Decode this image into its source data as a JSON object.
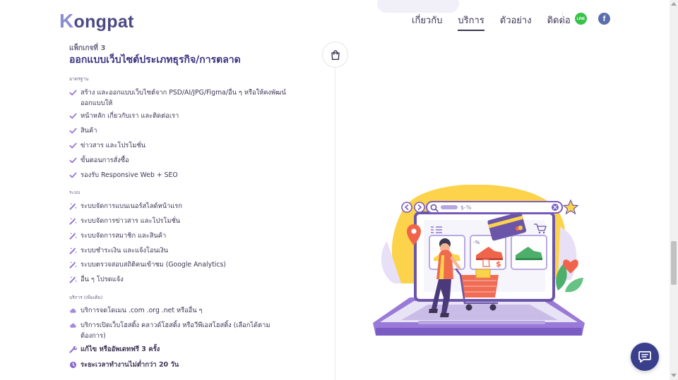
{
  "header": {
    "logo_k": "K",
    "logo_rest": "ongpat",
    "nav": [
      "เกี่ยวกับ",
      "บริการ",
      "ตัวอย่าง",
      "ติดต่อ"
    ],
    "active_nav": "บริการ",
    "line_label": "LINE",
    "facebook_label": "f"
  },
  "package": {
    "label": "แพ็กเกจที่ 3",
    "title": "ออกแบบเว็บไซต์ประเภทธุรกิจ/การตลาด"
  },
  "sections": {
    "standard_label": "มาตรฐาน",
    "standard_items": [
      "สร้าง และออกแบบเว็บไซต์จาก PSD/AI/JPG/Figma/อื่น ๆ หรือให้คงพัฒน์ออกแบบให้",
      "หน้าหลัก เกี่ยวกับเรา และติดต่อเรา",
      "สินค้า",
      "ข่าวสาร และโปรโมชั่น",
      "ขั้นตอนการสั่งซื้อ",
      "รองรับ Responsive Web + SEO"
    ],
    "system_label": "ระบบ",
    "system_items": [
      "ระบบจัดการแบนเนอร์สไลด์หน้าแรก",
      "ระบบจัดการข่าวสาร และโปรโมชั่น",
      "ระบบจัดการสมาชิก และสินค้า",
      "ระบบชำระเงิน และแจ้งโอนเงิน",
      "ระบบตรวจสอบสถิติคนเข้าชม (Google Analytics)",
      "อื่น ๆ โปรดแจ้ง"
    ],
    "service_label": "บริการ (เพิ่มเติม)",
    "service_items": [
      "บริการจดโดเมน .com .org .net หรืออื่น ๆ",
      "บริการเปิดเว็บโฮสติ้ง คลาวด์โฮสติ้ง หรือวีพีเอสโฮสติ้ง (เลือกได้ตามต้องการ)"
    ],
    "extras": [
      "แก้ไข หรืออัพเดทฟรี 3 ครั้ง",
      "ระยะเวลาทำงานไม่ต่ำกว่า 20 วัน"
    ]
  },
  "illustration": {
    "search_text": "$-%",
    "discount_text": "-%",
    "dollar_text": "$"
  },
  "colors": {
    "brand_dark": "#3b3480",
    "check": "#9a7ad8",
    "tool": "#8a6ad0",
    "cloud": "#a58be0",
    "chat": "#3a3f8c"
  }
}
